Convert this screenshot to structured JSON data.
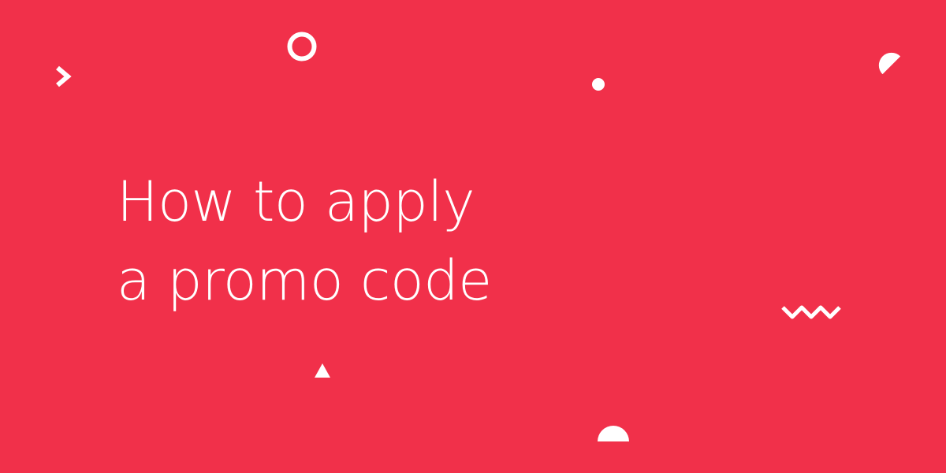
{
  "banner": {
    "title_line_1": "How to apply",
    "title_line_2": "a promo code",
    "background_color": "#f1304a",
    "text_color": "#ffffff"
  },
  "decorations": [
    {
      "icon": "chevron-right-icon",
      "color": "#ffffff"
    },
    {
      "icon": "ring-icon",
      "color": "#ffffff"
    },
    {
      "icon": "dot-icon",
      "color": "#ffffff"
    },
    {
      "icon": "half-circle-icon",
      "color": "#ffffff"
    },
    {
      "icon": "zigzag-icon",
      "color": "#ffffff"
    },
    {
      "icon": "triangle-icon",
      "color": "#ffffff"
    },
    {
      "icon": "semicircle-icon",
      "color": "#ffffff"
    }
  ]
}
